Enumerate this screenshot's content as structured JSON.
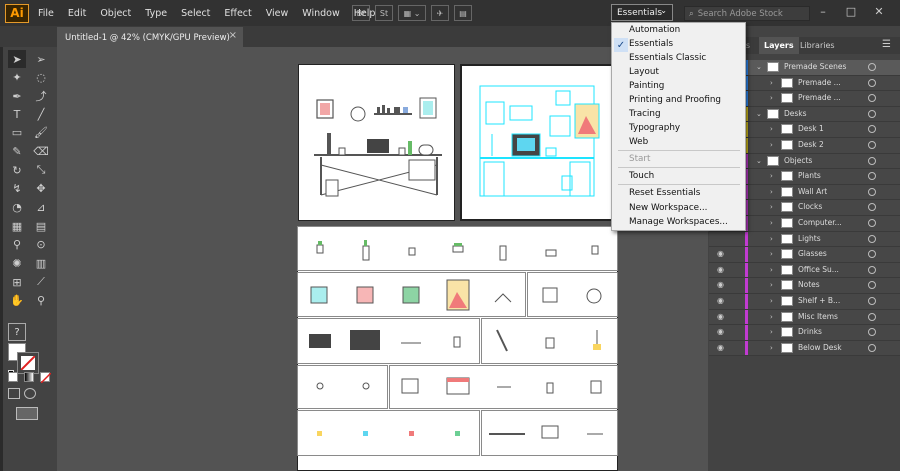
{
  "app": {
    "logo": "Ai"
  },
  "menubar": {
    "items": [
      "File",
      "Edit",
      "Object",
      "Type",
      "Select",
      "Effect",
      "View",
      "Window",
      "Help"
    ],
    "tool_buttons": [
      "Br",
      "St"
    ],
    "workspace": "Essentials",
    "search_placeholder": "Search Adobe Stock",
    "window_buttons": [
      "–",
      "□",
      "✕"
    ]
  },
  "document_tab": {
    "title": "Untitled-1 @ 42% (CMYK/GPU Preview)",
    "close": "×"
  },
  "panel": {
    "tabs": [
      "es",
      "Layers",
      "Libraries"
    ],
    "layers": [
      {
        "name": "Premade Scenes",
        "level": 0,
        "color": "#2f8fff",
        "expanded": true
      },
      {
        "name": "Premade ...",
        "level": 1,
        "color": "#2f8fff",
        "expanded": false
      },
      {
        "name": "Premade ...",
        "level": 1,
        "color": "#2f8fff",
        "expanded": false
      },
      {
        "name": "Desks",
        "level": 0,
        "color": "#d6c11c",
        "expanded": true
      },
      {
        "name": "Desk 1",
        "level": 1,
        "color": "#d6c11c",
        "expanded": false
      },
      {
        "name": "Desk 2",
        "level": 1,
        "color": "#d6c11c",
        "expanded": false
      },
      {
        "name": "Objects",
        "level": 0,
        "color": "#c13bd1",
        "expanded": true
      },
      {
        "name": "Plants",
        "level": 1,
        "color": "#c13bd1",
        "expanded": false
      },
      {
        "name": "Wall Art",
        "level": 1,
        "color": "#c13bd1",
        "expanded": false
      },
      {
        "name": "Clocks",
        "level": 1,
        "color": "#c13bd1",
        "expanded": false
      },
      {
        "name": "Computer...",
        "level": 1,
        "color": "#c13bd1",
        "expanded": false
      },
      {
        "name": "Lights",
        "level": 1,
        "color": "#c13bd1",
        "expanded": false
      },
      {
        "name": "Glasses",
        "level": 1,
        "color": "#c13bd1",
        "expanded": false
      },
      {
        "name": "Office Su...",
        "level": 1,
        "color": "#c13bd1",
        "expanded": false
      },
      {
        "name": "Notes",
        "level": 1,
        "color": "#c13bd1",
        "expanded": false
      },
      {
        "name": "Shelf + B...",
        "level": 1,
        "color": "#c13bd1",
        "expanded": false
      },
      {
        "name": "Misc Items",
        "level": 1,
        "color": "#c13bd1",
        "expanded": false
      },
      {
        "name": "Drinks",
        "level": 1,
        "color": "#c13bd1",
        "expanded": false
      },
      {
        "name": "Below Desk",
        "level": 1,
        "color": "#c13bd1",
        "expanded": false
      }
    ]
  },
  "workspace_menu": {
    "items": [
      {
        "label": "Automation",
        "checked": false,
        "disabled": false
      },
      {
        "label": "Essentials",
        "checked": true,
        "disabled": false
      },
      {
        "label": "Essentials Classic",
        "checked": false,
        "disabled": false
      },
      {
        "label": "Layout",
        "checked": false,
        "disabled": false
      },
      {
        "label": "Painting",
        "checked": false,
        "disabled": false
      },
      {
        "label": "Printing and Proofing",
        "checked": false,
        "disabled": false
      },
      {
        "label": "Tracing",
        "checked": false,
        "disabled": false
      },
      {
        "label": "Typography",
        "checked": false,
        "disabled": false
      },
      {
        "label": "Web",
        "checked": false,
        "disabled": false
      },
      {
        "label": "Start",
        "checked": false,
        "disabled": true
      },
      {
        "label": "Touch",
        "checked": false,
        "disabled": false
      },
      {
        "label": "Reset Essentials",
        "checked": false,
        "disabled": false
      },
      {
        "label": "New Workspace...",
        "checked": false,
        "disabled": false
      },
      {
        "label": "Manage Workspaces...",
        "checked": false,
        "disabled": false
      }
    ]
  },
  "colors": {
    "accent": "#2f8fff",
    "selection": "#1ee4ff",
    "chrome": "#323232"
  }
}
